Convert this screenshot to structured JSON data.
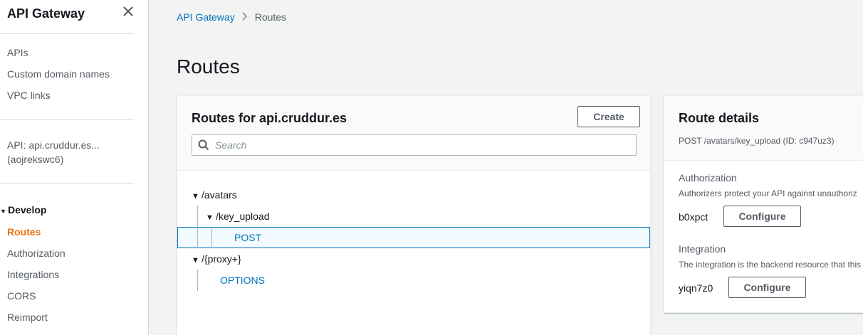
{
  "sidebar": {
    "title": "API Gateway",
    "top_items": [
      "APIs",
      "Custom domain names",
      "VPC links"
    ],
    "api_name": "API: api.cruddur.es...",
    "api_id": "(aojrekswc6)",
    "section": "Develop",
    "develop_items": [
      "Routes",
      "Authorization",
      "Integrations",
      "CORS",
      "Reimport"
    ],
    "active_item": "Routes"
  },
  "breadcrumb": {
    "root": "API Gateway",
    "current": "Routes"
  },
  "page": {
    "title": "Routes"
  },
  "routes_panel": {
    "title": "Routes for api.cruddur.es",
    "create_label": "Create",
    "search_placeholder": "Search",
    "tree": {
      "avatars": "/avatars",
      "key_upload": "/key_upload",
      "post": "POST",
      "proxy": "/{proxy+}",
      "options": "OPTIONS"
    },
    "selected": "POST"
  },
  "details_panel": {
    "title": "Route details",
    "subtitle": "POST /avatars/key_upload (ID: c947uz3)",
    "authorization": {
      "label": "Authorization",
      "description": "Authorizers protect your API against unauthoriz",
      "value": "b0xpct",
      "button": "Configure"
    },
    "integration": {
      "label": "Integration",
      "description": "The integration is the backend resource that this",
      "value": "yiqn7z0",
      "button": "Configure"
    }
  },
  "colors": {
    "accent": "#ec7211",
    "link": "#0073bb",
    "selected_bg": "#f1faff"
  }
}
